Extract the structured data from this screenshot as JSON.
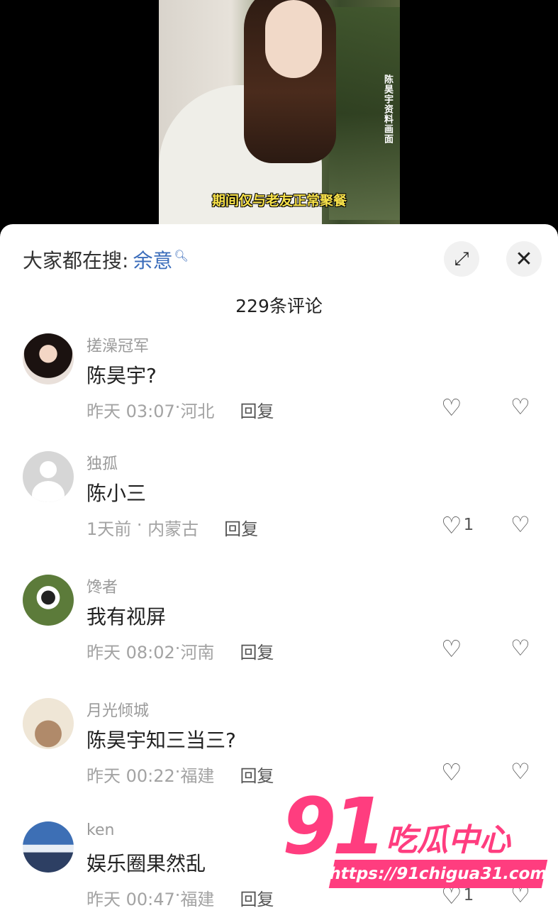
{
  "video": {
    "side_caption": "陈昊宇资料画面",
    "subtitle": "期间仅与老友正常聚餐"
  },
  "header": {
    "search_prefix": "大家都在搜:",
    "search_keyword": "余意",
    "expand_icon": "expand-icon",
    "close_icon": "close-icon"
  },
  "comments_title": "229条评论",
  "comments": [
    {
      "user": "搓澡冠军",
      "text": "陈昊宇?",
      "time": "昨天 03:07",
      "location": "河北",
      "reply": "回复",
      "likes": ""
    },
    {
      "user": "独孤",
      "text": "陈小三",
      "time": "1天前",
      "location": "内蒙古",
      "reply": "回复",
      "likes": "1"
    },
    {
      "user": "馋者",
      "text": "我有视屏",
      "time": "昨天 08:02",
      "location": "河南",
      "reply": "回复",
      "likes": ""
    },
    {
      "user": "月光倾城",
      "text": "陈昊宇知三当三?",
      "time": "昨天 00:22",
      "location": "福建",
      "reply": "回复",
      "likes": ""
    },
    {
      "user": "ken",
      "text": "娱乐圈果然乱",
      "time": "昨天 00:47",
      "location": "福建",
      "reply": "回复",
      "likes": "1"
    }
  ],
  "watermark": {
    "number": "91",
    "name": "吃瓜中心",
    "url": "https://91chigua31.com"
  }
}
